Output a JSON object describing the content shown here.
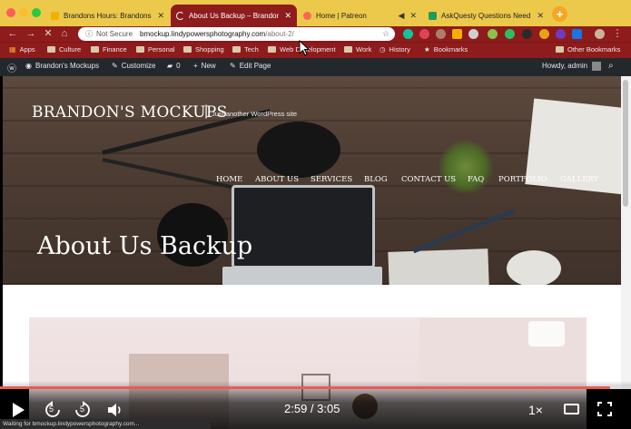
{
  "colors": {
    "tab_strip": "#ecc94b",
    "toolbar": "#8e1c1c",
    "wp_admin_bar": "#23282d",
    "progress": "#e95b5b"
  },
  "tabs": [
    {
      "title": "Brandons Hours: Brandons Ho",
      "icon": "spreadsheet-icon",
      "active": false
    },
    {
      "title": "About Us Backup – Brandon's",
      "icon": "loading-icon",
      "active": true
    },
    {
      "title": "Home | Patreon",
      "icon": "patreon-icon",
      "active": false
    },
    {
      "title": "AskQuesty Questions Need An",
      "icon": "spreadsheet-icon",
      "active": false
    }
  ],
  "address_bar": {
    "security": "Not Secure",
    "host": "bmockup.lindypowersphotography.com",
    "path": "/about-2/"
  },
  "bookmarks": [
    "Apps",
    "Culture",
    "Finance",
    "Personal",
    "Shopping",
    "Tech",
    "Web Development",
    "Work",
    "History",
    "Bookmarks",
    "Other Bookmarks"
  ],
  "wp_admin": {
    "site_name": "Brandon's Mockups",
    "customize": "Customize",
    "comments_count": "0",
    "new": "New",
    "edit_page": "Edit Page",
    "howdy": "Howdy, admin"
  },
  "site": {
    "title": "BRANDON'S MOCKUPS",
    "separator": "|",
    "tagline": "Just another WordPress site",
    "nav": [
      "HOME",
      "ABOUT US",
      "SERVICES",
      "BLOG",
      "CONTACT US",
      "FAQ",
      "PORTFOLIO",
      "GALLERY"
    ],
    "page_title": "About Us Backup"
  },
  "video": {
    "progress_fraction": 0.967,
    "skip_back": "5",
    "skip_forward": "5",
    "time": "2:59 / 3:05",
    "speed": "1×"
  },
  "status_bar": "Waiting for bmockup.lindypowersphotography.com..."
}
